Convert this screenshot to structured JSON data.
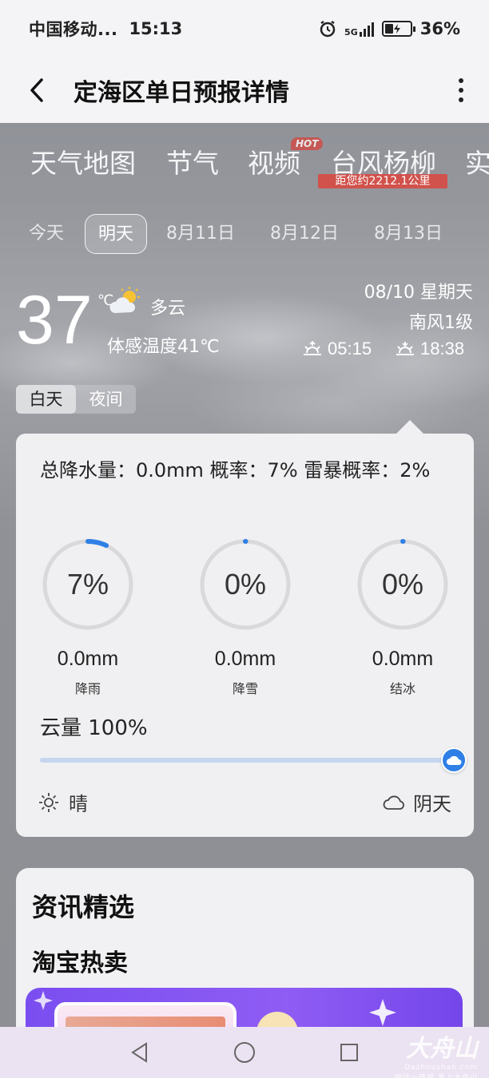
{
  "status_bar": {
    "carrier": "中国移动...",
    "time": "15:13",
    "network": "5G",
    "battery": "36%"
  },
  "app_bar": {
    "title": "定海区单日预报详情"
  },
  "category_tabs": [
    {
      "label": "天气地图"
    },
    {
      "label": "节气"
    },
    {
      "label": "视频",
      "badge": "HOT"
    },
    {
      "label": "台风杨柳",
      "note": "距您约2212.1公里"
    },
    {
      "label": "实"
    }
  ],
  "day_tabs": [
    {
      "label": "今天",
      "active": false
    },
    {
      "label": "明天",
      "active": true
    },
    {
      "label": "8月11日",
      "active": false
    },
    {
      "label": "8月12日",
      "active": false
    },
    {
      "label": "8月13日",
      "active": false
    }
  ],
  "current": {
    "temperature": "37",
    "unit": "℃",
    "condition": "多云",
    "condition_icon": "partly-cloudy-icon",
    "feels_like": "体感温度41℃",
    "date": "08/10 星期天",
    "wind": "南风1级",
    "sunrise": "05:15",
    "sunset": "18:38"
  },
  "period_toggle": {
    "day": "白天",
    "night": "夜间",
    "selected": "day"
  },
  "precip_card": {
    "summary": "总降水量：0.0mm  概率：7%  雷暴概率：2%",
    "items": [
      {
        "percent": "7%",
        "value": 0.07,
        "amount": "0.0mm",
        "label": "降雨"
      },
      {
        "percent": "0%",
        "value": 0,
        "amount": "0.0mm",
        "label": "降雪"
      },
      {
        "percent": "0%",
        "value": 0,
        "amount": "0.0mm",
        "label": "结冰"
      }
    ],
    "cloud_cover": {
      "label": "云量 100%",
      "value": 1.0,
      "min_label": "晴",
      "max_label": "阴天"
    }
  },
  "news": {
    "title": "资讯精选",
    "subtitle": "淘宝热卖"
  },
  "watermark": {
    "brand": "大舟山",
    "domain": "Dazhoushan.com",
    "slogan": "网住一座城 爱上大舟山"
  },
  "colors": {
    "accent": "#2f7fe6",
    "badge_red": "#d24a43",
    "ring_track": "#d9d9db"
  }
}
